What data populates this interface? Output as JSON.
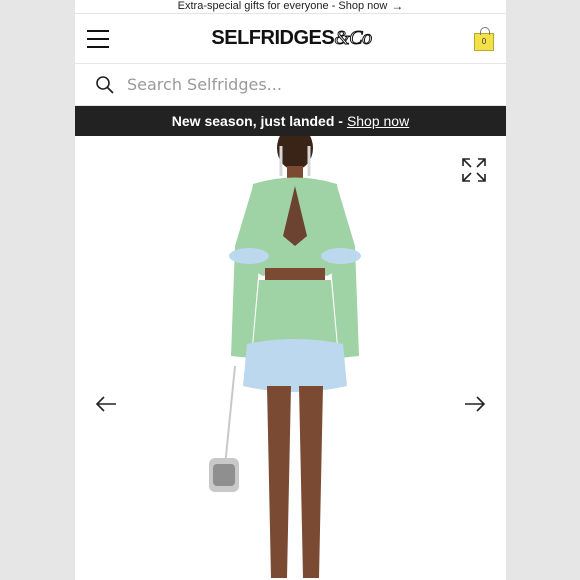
{
  "promo": {
    "text": "Extra-special gifts for everyone - Shop now",
    "arrow": "→"
  },
  "header": {
    "logo_main": "SELFRIDGES",
    "logo_amp": "&Co",
    "bag_count": "0"
  },
  "search": {
    "placeholder": "Search Selfridges..."
  },
  "banner": {
    "text": "New season, just landed - ",
    "link": "Shop now"
  },
  "colors": {
    "banner_bg": "#222222",
    "bag": "#f3e14a",
    "jacket": "#9fd3a6",
    "feather": "#bcd8ee"
  },
  "icons": [
    "menu-icon",
    "bag-icon",
    "search-icon",
    "expand-icon",
    "arrow-left-icon",
    "arrow-right-icon"
  ]
}
